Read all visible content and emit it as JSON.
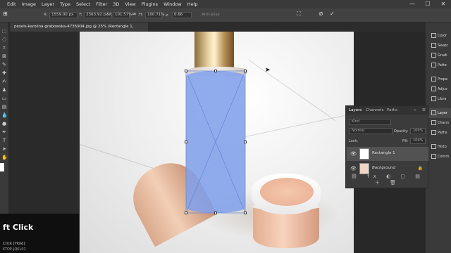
{
  "menu": [
    "Edit",
    "Image",
    "Layer",
    "Type",
    "Select",
    "Filter",
    "3D",
    "View",
    "Plugins",
    "Window",
    "Help"
  ],
  "window_controls": [
    "—",
    "☐",
    "✕"
  ],
  "options": {
    "x_label": "X:",
    "x_value": "1559.00 px",
    "y_label": "Y:",
    "y_value": "2363.92 px",
    "w_label": "W:",
    "w_value": "101.57%",
    "link": "∞",
    "h_label": "H:",
    "h_value": "100.71%",
    "angle_value": "0.66",
    "anti_alias": "Anti-alias",
    "cancel": "⊘",
    "commit": "✓"
  },
  "document_tab": "pexels-karolina-grabowska-4735904.jpg @ 25% (Rectangle 1, RGB/8) *",
  "keycast": {
    "main": "ft Click",
    "sub": "Click [Hold]",
    "footer": "KTOP-JQKL01"
  },
  "right_panels": [
    {
      "label": "Color",
      "icon": "color-icon"
    },
    {
      "label": "Swatc",
      "icon": "swatches-icon"
    },
    {
      "label": "Gradi",
      "icon": "gradients-icon"
    },
    {
      "label": "Patte",
      "icon": "patterns-icon"
    },
    {
      "label": "Prope",
      "icon": "properties-icon"
    },
    {
      "label": "Adjus",
      "icon": "adjustments-icon"
    },
    {
      "label": "Libra",
      "icon": "libraries-icon"
    },
    {
      "label": "Layer",
      "icon": "layers-icon"
    },
    {
      "label": "Chann",
      "icon": "channels-icon"
    },
    {
      "label": "Paths",
      "icon": "paths-icon"
    },
    {
      "label": "Histo",
      "icon": "history-icon"
    },
    {
      "label": "Comm",
      "icon": "comments-icon"
    }
  ],
  "layers_panel": {
    "tabs": [
      "Layers",
      "Channels",
      "Paths"
    ],
    "kind_placeholder": "Kind",
    "blend_mode": "Normal",
    "opacity_label": "Opacity:",
    "opacity_value": "100%",
    "lock_label": "Lock:",
    "fill_label": "Fill:",
    "fill_value": "100%",
    "layers": [
      {
        "name": "Rectangle 1",
        "selected": true
      },
      {
        "name": "Background",
        "selected": false
      }
    ],
    "footer_icons": "⛓ fx ◐ ▢ ▤ ＋ 🗑"
  }
}
